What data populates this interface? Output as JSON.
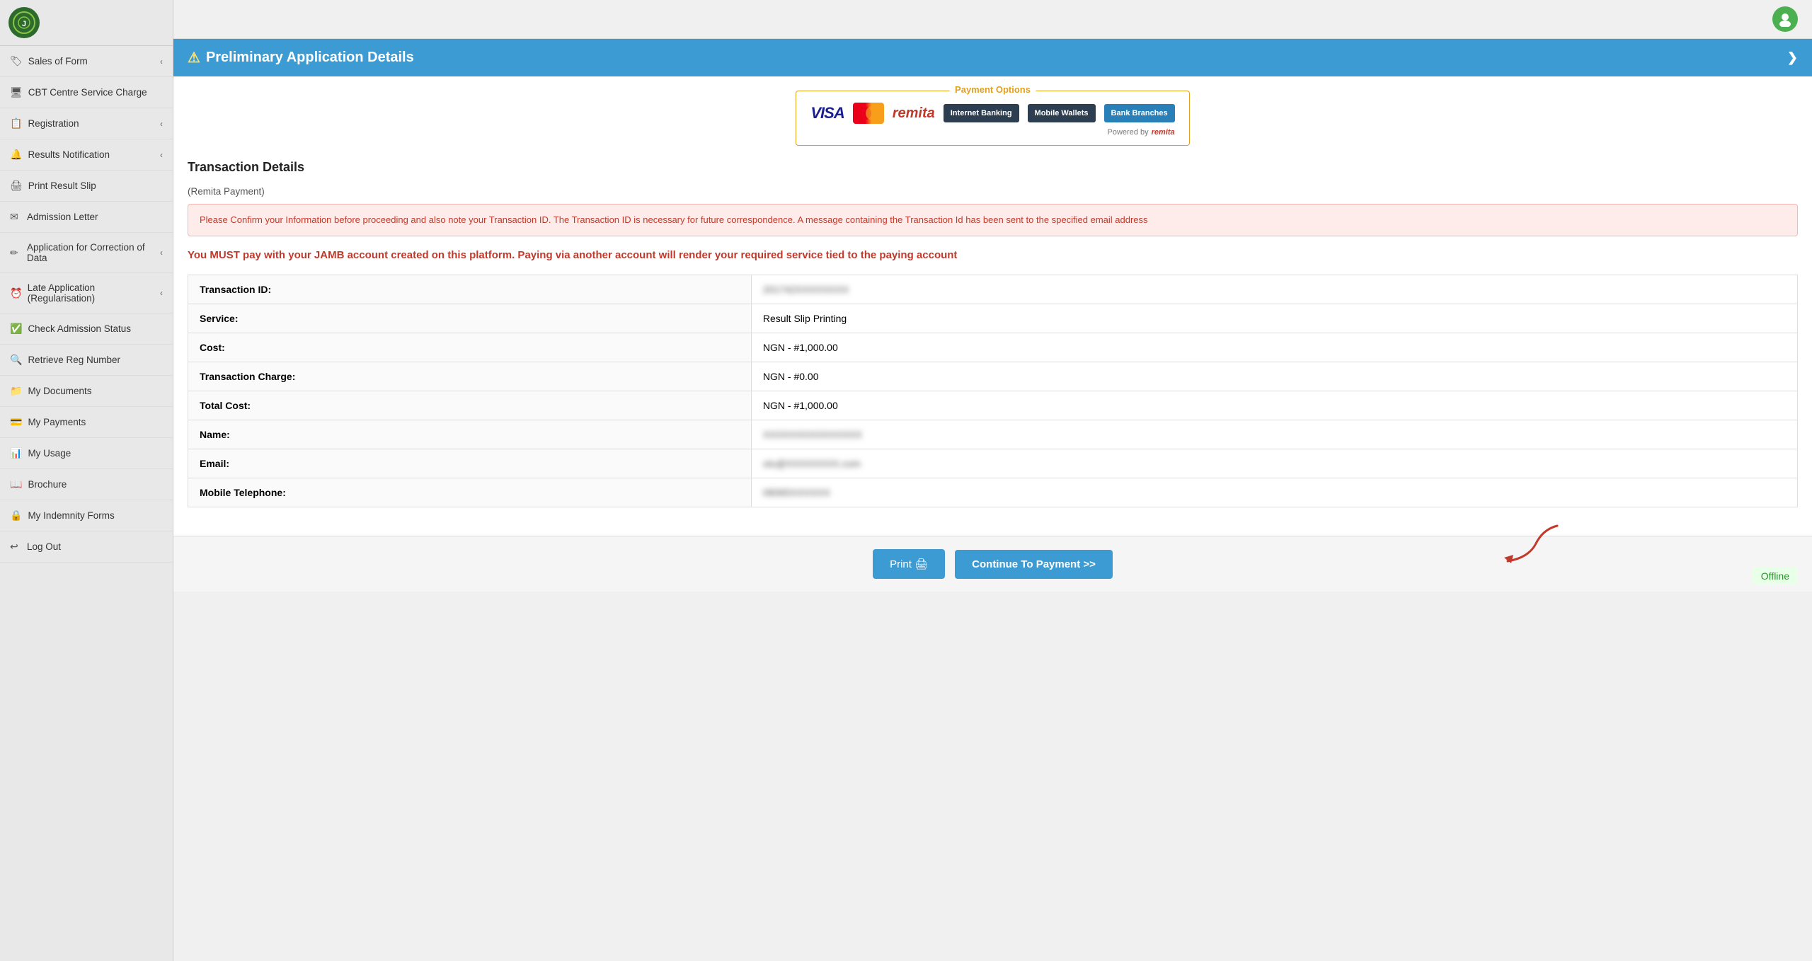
{
  "sidebar": {
    "items": [
      {
        "id": "sales-of-form",
        "label": "Sales of Form",
        "icon": "🏷",
        "hasChevron": true
      },
      {
        "id": "cbt-centre",
        "label": "CBT Centre Service Charge",
        "icon": "🖥",
        "hasChevron": false
      },
      {
        "id": "registration",
        "label": "Registration",
        "icon": "📋",
        "hasChevron": true
      },
      {
        "id": "results-notification",
        "label": "Results Notification",
        "icon": "🔔",
        "hasChevron": true
      },
      {
        "id": "print-result-slip",
        "label": "Print Result Slip",
        "icon": "🖨",
        "hasChevron": false
      },
      {
        "id": "admission-letter",
        "label": "Admission Letter",
        "icon": "✉",
        "hasChevron": false
      },
      {
        "id": "application-correction",
        "label": "Application for Correction of Data",
        "icon": "✏",
        "hasChevron": true
      },
      {
        "id": "late-application",
        "label": "Late Application (Regularisation)",
        "icon": "⏰",
        "hasChevron": true
      },
      {
        "id": "check-admission",
        "label": "Check Admission Status",
        "icon": "✅",
        "hasChevron": false
      },
      {
        "id": "retrieve-reg",
        "label": "Retrieve Reg Number",
        "icon": "🔍",
        "hasChevron": false
      },
      {
        "id": "my-documents",
        "label": "My Documents",
        "icon": "📁",
        "hasChevron": false
      },
      {
        "id": "my-payments",
        "label": "My Payments",
        "icon": "💳",
        "hasChevron": false
      },
      {
        "id": "my-usage",
        "label": "My Usage",
        "icon": "📊",
        "hasChevron": false
      },
      {
        "id": "brochure",
        "label": "Brochure",
        "icon": "📖",
        "hasChevron": false
      },
      {
        "id": "my-indemnity",
        "label": "My Indemnity Forms",
        "icon": "🔒",
        "hasChevron": false
      },
      {
        "id": "log-out",
        "label": "Log Out",
        "icon": "↩",
        "hasChevron": false
      }
    ]
  },
  "panel": {
    "header_title": "Preliminary Application Details",
    "warning_icon": "⚠",
    "chevron_icon": "❯"
  },
  "payment_options": {
    "label": "Payment Options",
    "powered_by": "Powered by",
    "internet_banking": "Internet Banking",
    "mobile_wallets": "Mobile Wallets",
    "bank_branches": "Bank Branches"
  },
  "transaction": {
    "section_title": "Transaction Details",
    "remita_label": "(Remita Payment)",
    "alert_message": "Please Confirm your Information before proceeding and also note your Transaction ID. The Transaction ID is necessary for future correspondence. A message containing the Transaction Id has been sent to the specified email address",
    "warning_message": "You MUST pay with your JAMB account created on this platform. Paying via another account will render your required service tied to the paying account",
    "fields": [
      {
        "label": "Transaction ID:",
        "value": "201742XXXXXXXX",
        "blurred": true
      },
      {
        "label": "Service:",
        "value": "Result Slip Printing",
        "blurred": false
      },
      {
        "label": "Cost:",
        "value": "NGN - #1,000.00",
        "blurred": false
      },
      {
        "label": "Transaction Charge:",
        "value": "NGN - #0.00",
        "blurred": false
      },
      {
        "label": "Total Cost:",
        "value": "NGN - #1,000.00",
        "blurred": false
      },
      {
        "label": "Name:",
        "value": "XXXXXXXXXXXXXXX",
        "blurred": true
      },
      {
        "label": "Email:",
        "value": "olu@XXXXXXXX.com",
        "blurred": true
      },
      {
        "label": "Mobile Telephone:",
        "value": "08065XXXXXX",
        "blurred": true
      }
    ]
  },
  "footer": {
    "print_label": "Print 🖨",
    "continue_label": "Continue To Payment >>",
    "offline_label": "Offline"
  }
}
